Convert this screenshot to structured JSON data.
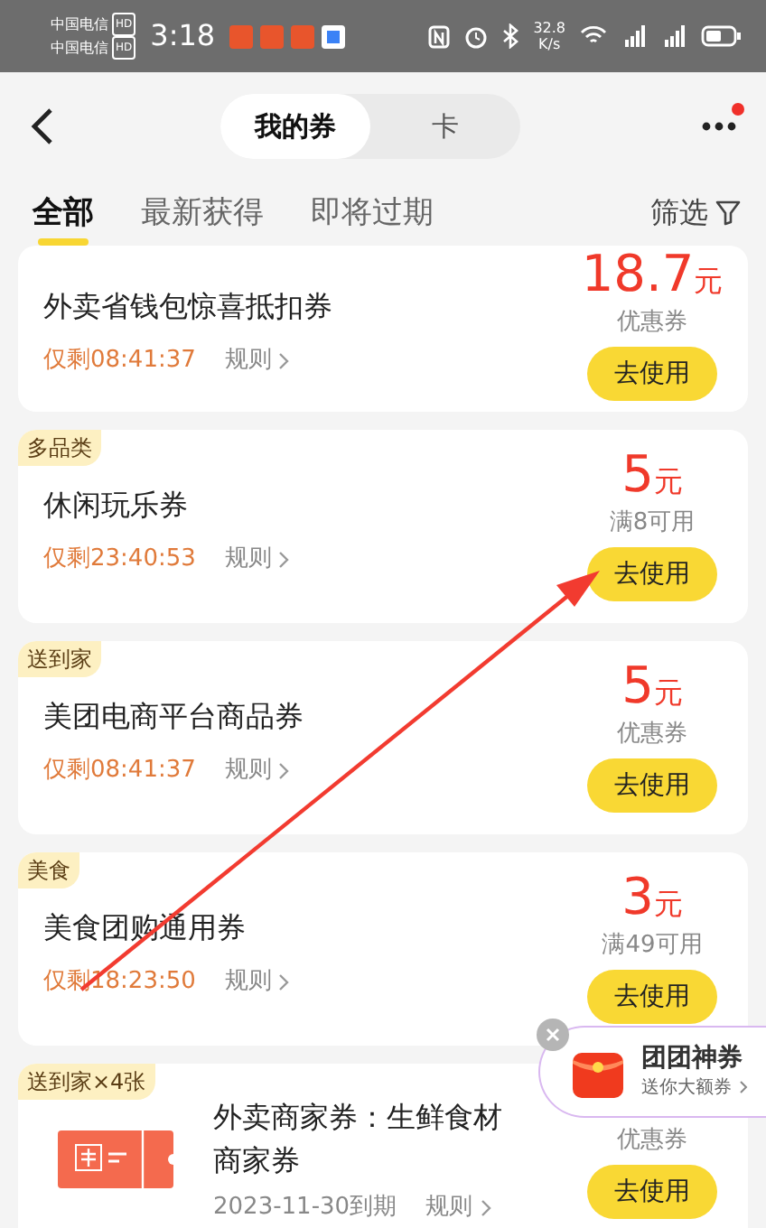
{
  "status_bar": {
    "carriers": [
      {
        "name": "中国电信",
        "badge": "HD"
      },
      {
        "name": "中国电信",
        "badge": "HD"
      }
    ],
    "time": "3:18",
    "speed_value": "32.8",
    "speed_unit": "K/s"
  },
  "header": {
    "segments": [
      {
        "label": "我的券",
        "selected": true
      },
      {
        "label": "卡",
        "selected": false
      }
    ],
    "menu_badge": true
  },
  "tabs": [
    {
      "label": "全部",
      "selected": true
    },
    {
      "label": "最新获得",
      "selected": false
    },
    {
      "label": "即将过期",
      "selected": false
    }
  ],
  "filter": {
    "label": "筛选"
  },
  "coupons": [
    {
      "kind": "text",
      "title": "外卖省钱包惊喜抵扣券",
      "validity": "仅剩08:41:37",
      "urgent": true,
      "rules": "规则",
      "amount": "18.7",
      "unit": "元",
      "condition": "优惠券",
      "action": "去使用"
    },
    {
      "kind": "text",
      "tag": "多品类",
      "title": "休闲玩乐券",
      "validity": "仅剩23:40:53",
      "urgent": true,
      "rules": "规则",
      "amount": "5",
      "unit": "元",
      "condition": "满8可用",
      "action": "去使用"
    },
    {
      "kind": "text",
      "tag": "送到家",
      "title": "美团电商平台商品券",
      "validity": "仅剩08:41:37",
      "urgent": true,
      "rules": "规则",
      "amount": "5",
      "unit": "元",
      "condition": "优惠券",
      "action": "去使用"
    },
    {
      "kind": "text",
      "tag": "美食",
      "title": "美食团购通用券",
      "validity": "仅剩18:23:50",
      "urgent": true,
      "rules": "规则",
      "amount": "3",
      "unit": "元",
      "condition": "满49可用",
      "action": "去使用"
    },
    {
      "kind": "ticket",
      "tag": "送到家×4张",
      "title": "外卖商家券：生鲜食材商家券",
      "validity": "2023-11-30到期",
      "urgent": false,
      "rules": "规则",
      "condition": "优惠券",
      "action": "去使用"
    }
  ],
  "promo": {
    "title": "团团神券",
    "subtitle": "送你大额券"
  },
  "annotation": {
    "kind": "arrow"
  }
}
